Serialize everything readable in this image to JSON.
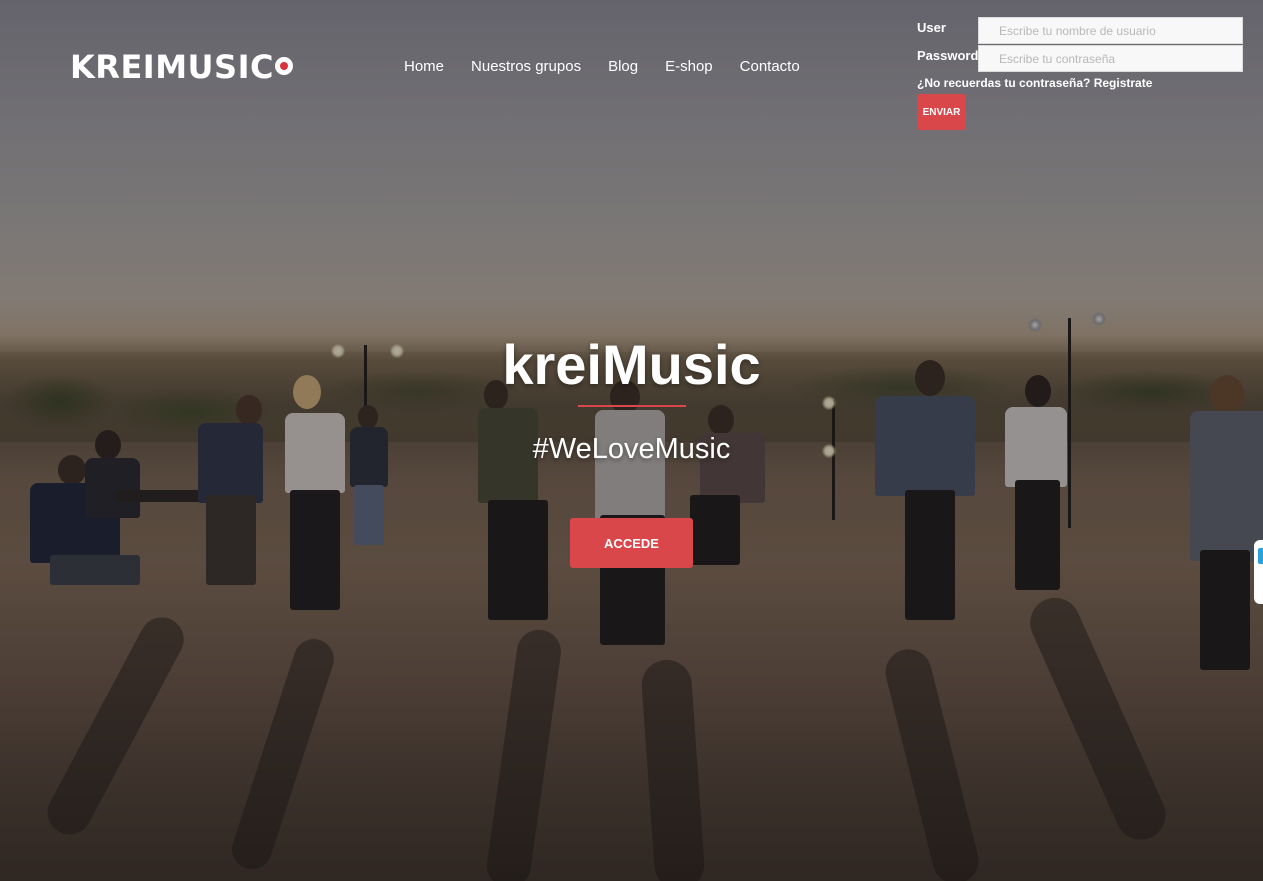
{
  "brand": {
    "logo_text": "KREIMUSIC",
    "accent_color": "#d9474a"
  },
  "nav": {
    "items": [
      {
        "label": "Home"
      },
      {
        "label": "Nuestros grupos"
      },
      {
        "label": "Blog"
      },
      {
        "label": "E-shop"
      },
      {
        "label": "Contacto"
      }
    ]
  },
  "login": {
    "user_label": "User",
    "user_placeholder": "Escribe tu nombre de usuario",
    "password_label": "Password",
    "password_placeholder": "Escribe tu contraseña",
    "help_text": "¿No recuerdas tu contraseña? Registrate",
    "submit_label": "ENVIAR"
  },
  "hero": {
    "title": "kreiMusic",
    "tagline": "#WeLoveMusic",
    "cta_label": "ACCEDE",
    "background": "outdoor band performing at sunset"
  }
}
